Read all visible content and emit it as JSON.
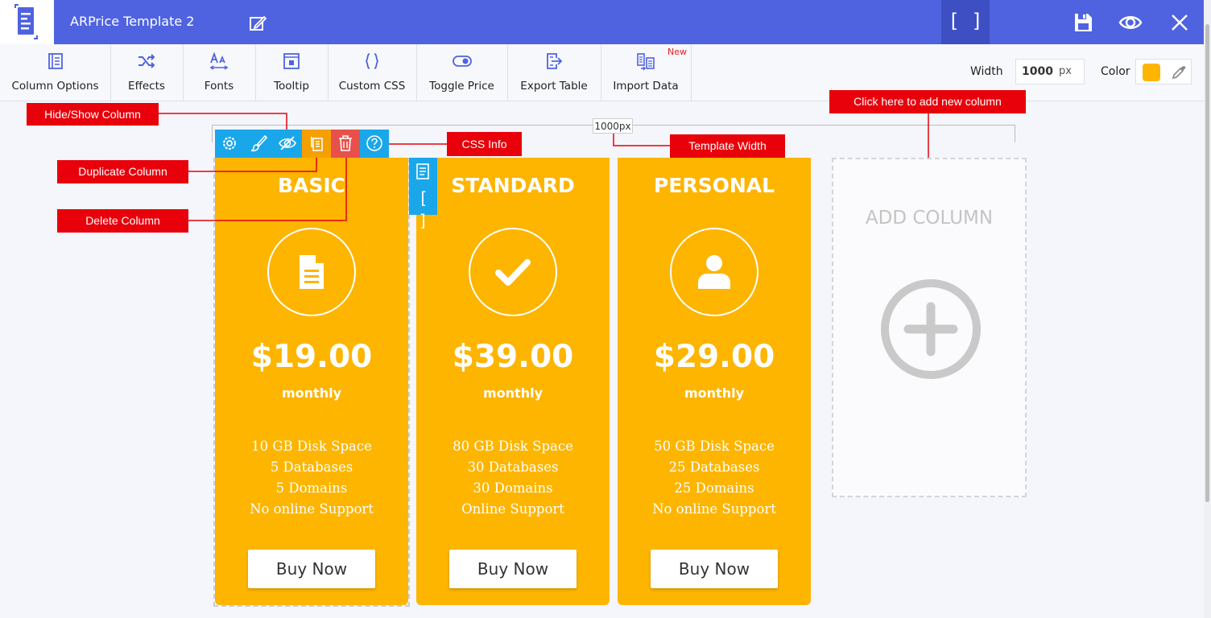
{
  "header": {
    "title": "ARPrice Template 2",
    "bracket_label": "[ ]",
    "icons": [
      "document-logo-icon",
      "edit-icon",
      "save-icon",
      "eye-icon",
      "close-icon"
    ]
  },
  "toolbar": {
    "items": [
      {
        "label": "Column Options",
        "icon": "columns-icon"
      },
      {
        "label": "Effects",
        "icon": "shuffle-icon"
      },
      {
        "label": "Fonts",
        "icon": "font-size-icon"
      },
      {
        "label": "Tooltip",
        "icon": "tooltip-icon"
      },
      {
        "label": "Custom CSS",
        "icon": "braces-icon"
      },
      {
        "label": "Toggle Price",
        "icon": "toggle-icon"
      },
      {
        "label": "Export Table",
        "icon": "export-icon"
      },
      {
        "label": "Import Data",
        "icon": "import-icon"
      }
    ],
    "new_badge": "New",
    "width_label": "Width",
    "width_value": "1000",
    "width_unit": "px",
    "color_label": "Color",
    "color_value": "#fdb500"
  },
  "canvas": {
    "template_width_tag": "1000px",
    "side_bracket": "[ ]"
  },
  "column_toolbar": {
    "buttons": [
      "settings-icon",
      "brush-icon",
      "eye-off-icon",
      "duplicate-icon",
      "delete-icon",
      "help-icon"
    ],
    "colors": {
      "primary": "#1aa7ea",
      "duplicate": "#f5a000",
      "delete": "#e8504b"
    }
  },
  "plans": [
    {
      "title": "BASIC",
      "icon": "document-icon",
      "price": "$19.00",
      "period": "monthly",
      "features": [
        "10 GB Disk Space",
        "5 Databases",
        "5 Domains",
        "No online Support"
      ],
      "button": "Buy Now"
    },
    {
      "title": "STANDARD",
      "icon": "checkmark-icon",
      "price": "$39.00",
      "period": "monthly",
      "features": [
        "80 GB Disk Space",
        "30 Databases",
        "30 Domains",
        "Online Support"
      ],
      "button": "Buy Now"
    },
    {
      "title": "PERSONAL",
      "icon": "user-icon",
      "price": "$29.00",
      "period": "monthly",
      "features": [
        "50 GB Disk Space",
        "25 Databases",
        "25 Domains",
        "No online Support"
      ],
      "button": "Buy Now"
    }
  ],
  "add_column": {
    "label": "ADD COLUMN",
    "icon": "plus-circle-icon"
  },
  "callouts": {
    "hide_show": "Hide/Show Column",
    "duplicate": "Duplicate Column",
    "delete": "Delete Column",
    "css_info": "CSS Info",
    "template_width": "Template Width",
    "add_new": "Click here to add new column"
  },
  "colors": {
    "header": "#4f63e0",
    "accent": "#fdb500",
    "callout": "#e8000b"
  }
}
